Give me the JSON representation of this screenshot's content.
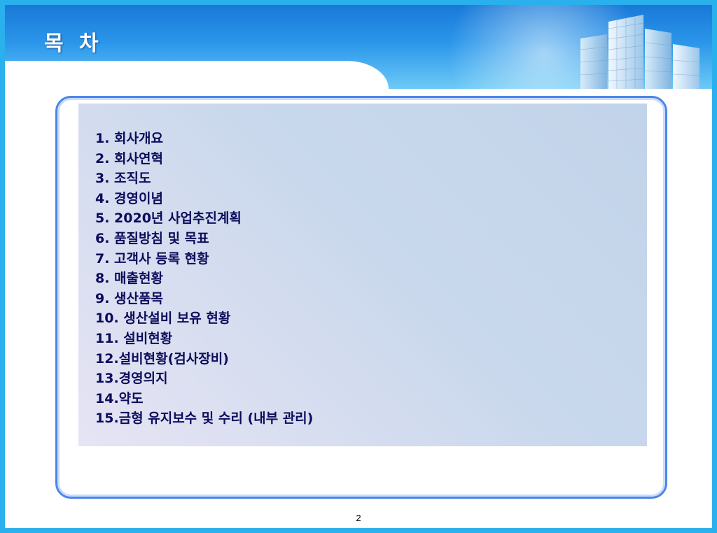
{
  "slide": {
    "title": "목 차",
    "page_number": "2"
  },
  "toc": {
    "items": [
      "1. 회사개요",
      "2. 회사연혁",
      "3. 조직도",
      "4. 경영이념",
      "5. 2020년 사업추진계획",
      "6. 품질방침 및 목표",
      "7. 고객사 등록 현황",
      "8. 매출현황",
      "9. 생산품목",
      "10. 생산설비 보유 현황",
      "11. 설비현황",
      "12.설비현황(검사장비)",
      "13.경영의지",
      "14.약도",
      "15.금형 유지보수 및 수리 (내부 관리)"
    ]
  },
  "colors": {
    "frame_border": "#2ab0ec",
    "header_blue": "#1a78d8",
    "content_border": "#4a86e8",
    "toc_text": "#0c0c5c"
  },
  "icons": [
    "building-skyline-image"
  ]
}
